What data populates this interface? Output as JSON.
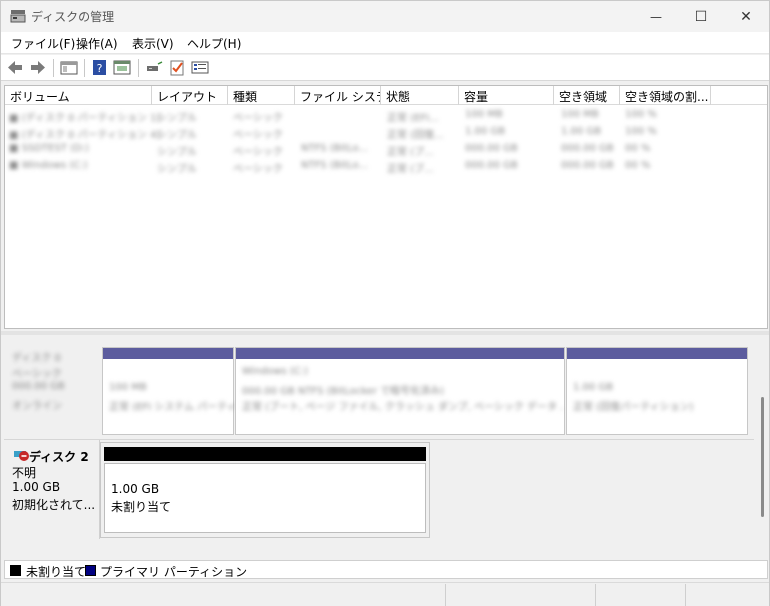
{
  "window": {
    "title": "ディスクの管理",
    "minimize_glyph": "—",
    "maximize_glyph": "☐",
    "close_glyph": "✕"
  },
  "menu": [
    "ファイル(F)",
    "操作(A)",
    "表示(V)",
    "ヘルプ(H)"
  ],
  "toolbar": [
    "back-icon",
    "forward-icon",
    "show-hide-console-tree-icon",
    "help-icon",
    "properties-icon",
    "connect-icon",
    "check-icon",
    "list-view-icon"
  ],
  "volume_list": {
    "columns": [
      "ボリューム",
      "レイアウト",
      "種類",
      "ファイル システム",
      "状態",
      "容量",
      "空き領域",
      "空き領域の割..."
    ],
    "rows": [
      [
        "■ (ディスク 0 パーティション 1)",
        "シンプル",
        "ベーシック",
        "",
        "正常 (EFI...",
        "100 MB",
        "100 MB",
        "100 %"
      ],
      [
        "■ (ディスク 0 パーティション 4)",
        "シンプル",
        "ベーシック",
        "",
        "正常 (回復...",
        "1.00 GB",
        "1.00 GB",
        "100 %"
      ],
      [
        "■ SSDTEST (D:)",
        "シンプル",
        "ベーシック",
        "NTFS (BitLo...",
        "正常 (プ...",
        "000.00 GB",
        "000.00 GB",
        "00 %"
      ],
      [
        "■ Windows (C:)",
        "シンプル",
        "ベーシック",
        "NTFS (BitLo...",
        "正常 (ブ...",
        "000.00 GB",
        "000.00 GB",
        "00 %"
      ]
    ]
  },
  "disks": {
    "disk0": {
      "label_lines": [
        "ディスク 0",
        "ベーシック",
        "000.00 GB",
        "オンライン"
      ],
      "partitions": [
        {
          "lines": [
            "100 MB",
            "正常 (EFI システム パーティション)"
          ]
        },
        {
          "lines": [
            "Windows (C:)",
            "000.00 GB NTFS (BitLocker で暗号化済み)",
            "正常 (ブート, ページ ファイル, クラッシュ ダンプ, ベーシック データ パーティション)"
          ]
        },
        {
          "lines": [
            "1.00 GB",
            "正常 (回復パーティション)"
          ]
        }
      ]
    },
    "disk2": {
      "name": "ディスク 2",
      "status": "不明",
      "size": "1.00 GB",
      "state": "初期化されて...",
      "partition_size": "1.00 GB",
      "partition_state": "未割り当て"
    }
  },
  "legend": {
    "unallocated": "未割り当て",
    "primary": "プライマリ パーティション",
    "unallocated_color": "#000000",
    "primary_color": "#000080"
  },
  "colors": {
    "partition_header": "#5c5c9e",
    "unallocated_header": "#000000"
  }
}
